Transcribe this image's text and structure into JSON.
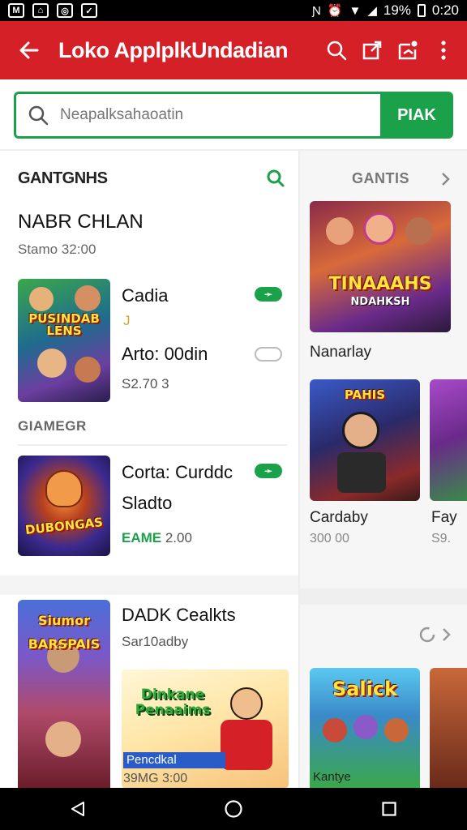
{
  "status_bar": {
    "time": "0:20",
    "battery": "19%"
  },
  "app_bar": {
    "title": "Loko Applplk​Undadian"
  },
  "search": {
    "placeholder": "Neapalksahaoatin",
    "button_label": "PIAK"
  },
  "left": {
    "section_title": "GANTGNHS",
    "subtitle": "NABR CHLAN",
    "subtitle_meta": "Stamo 32:00",
    "item1": {
      "thumb_text": "PUSINDAB LENS",
      "title": "Cadia",
      "mark": "J",
      "line2": "Arto: 00din",
      "price": "S2.70  3"
    },
    "category": "GIAMEGR",
    "item2": {
      "thumb_text": "DUBONGAS",
      "title": "Corta: Curddc",
      "line2": "Sladto",
      "price_tag": "EAME",
      "price": " 2.00"
    },
    "item3": {
      "thumb_text": "Siumor BARSPAIS",
      "title": "DADK Cealkts",
      "meta": "Sar10adby",
      "banner_text": "Dinkane Penaaims",
      "banner_label": "Pencdkal",
      "price": "39MG  3:00"
    }
  },
  "right": {
    "section_title": "GANTIS",
    "card1": {
      "thumb_text": "TINAAAHS",
      "thumb_sub": "NDAHKSH",
      "caption": "Nanarlay"
    },
    "card2": {
      "thumb_text": "PAHIS",
      "caption": "Cardaby",
      "meta": "300  00"
    },
    "card3": {
      "caption": "Fay",
      "meta": "S9."
    },
    "card4": {
      "thumb_text": "Salick",
      "caption": "Kantye"
    }
  },
  "colors": {
    "brand_red": "#d62027",
    "accent_green": "#1aa14a"
  }
}
